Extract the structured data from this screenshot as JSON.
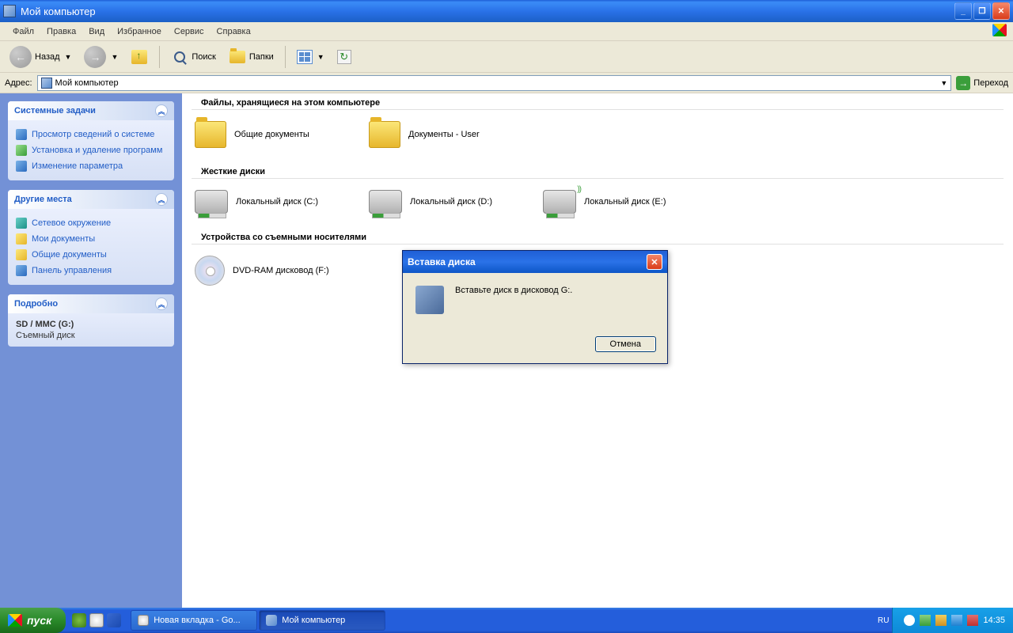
{
  "window": {
    "title": "Мой компьютер"
  },
  "menu": {
    "items": [
      "Файл",
      "Правка",
      "Вид",
      "Избранное",
      "Сервис",
      "Справка"
    ]
  },
  "toolbar": {
    "back": "Назад",
    "search": "Поиск",
    "folders": "Папки"
  },
  "address": {
    "label": "Адрес:",
    "value": "Мой компьютер",
    "go": "Переход"
  },
  "sidebar": {
    "tasks": {
      "title": "Системные задачи",
      "items": [
        "Просмотр сведений о системе",
        "Установка и удаление программ",
        "Изменение параметра"
      ]
    },
    "places": {
      "title": "Другие места",
      "items": [
        "Сетевое окружение",
        "Мои документы",
        "Общие документы",
        "Панель управления"
      ]
    },
    "details": {
      "title": "Подробно",
      "name": "SD / MMC (G:)",
      "type": "Съемный диск"
    }
  },
  "main": {
    "sections": {
      "files": {
        "title": "Файлы, хранящиеся на этом компьютере",
        "items": [
          "Общие документы",
          "Документы - User"
        ]
      },
      "hdd": {
        "title": "Жесткие диски",
        "items": [
          "Локальный диск (C:)",
          "Локальный диск (D:)",
          "Локальный диск (E:)"
        ]
      },
      "removable": {
        "title": "Устройства со съемными носителями",
        "items": [
          "DVD-RAM дисковод (F:)"
        ]
      }
    }
  },
  "dialog": {
    "title": "Вставка диска",
    "message": "Вставьте диск в дисковод G:.",
    "cancel": "Отмена"
  },
  "taskbar": {
    "start": "пуск",
    "tasks": [
      "Новая вкладка - Go...",
      "Мой компьютер"
    ],
    "lang": "RU",
    "time": "14:35"
  }
}
